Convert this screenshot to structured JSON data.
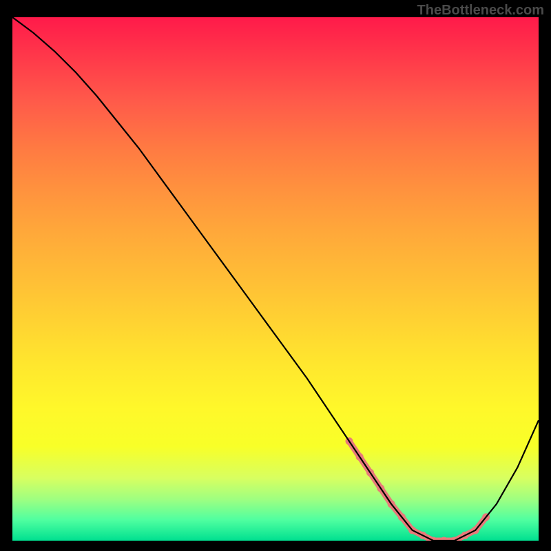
{
  "watermark": "TheBottleneck.com",
  "chart_data": {
    "type": "line",
    "title": "",
    "xlabel": "",
    "ylabel": "",
    "xlim": [
      0,
      100
    ],
    "ylim": [
      0,
      100
    ],
    "series": [
      {
        "name": "bottleneck-curve",
        "x": [
          0,
          4,
          8,
          12,
          16,
          20,
          24,
          28,
          32,
          36,
          40,
          44,
          48,
          52,
          56,
          60,
          64,
          68,
          72,
          76,
          80,
          84,
          88,
          92,
          96,
          100
        ],
        "values": [
          100,
          97,
          93.5,
          89.5,
          85,
          80,
          75,
          69.5,
          64,
          58.5,
          53,
          47.5,
          42,
          36.5,
          31,
          25,
          19,
          13,
          7,
          2,
          0,
          0,
          2,
          7,
          14,
          23
        ]
      }
    ],
    "highlight": {
      "along_curve_x_range": [
        64,
        90
      ],
      "dots_x": [
        64,
        66,
        68,
        70,
        72,
        74,
        76,
        78,
        80,
        82,
        84,
        86,
        88,
        90
      ]
    },
    "gradient_colors": {
      "top": "#ff1a4a",
      "mid": "#ffe62e",
      "bottom": "#00e090"
    }
  }
}
